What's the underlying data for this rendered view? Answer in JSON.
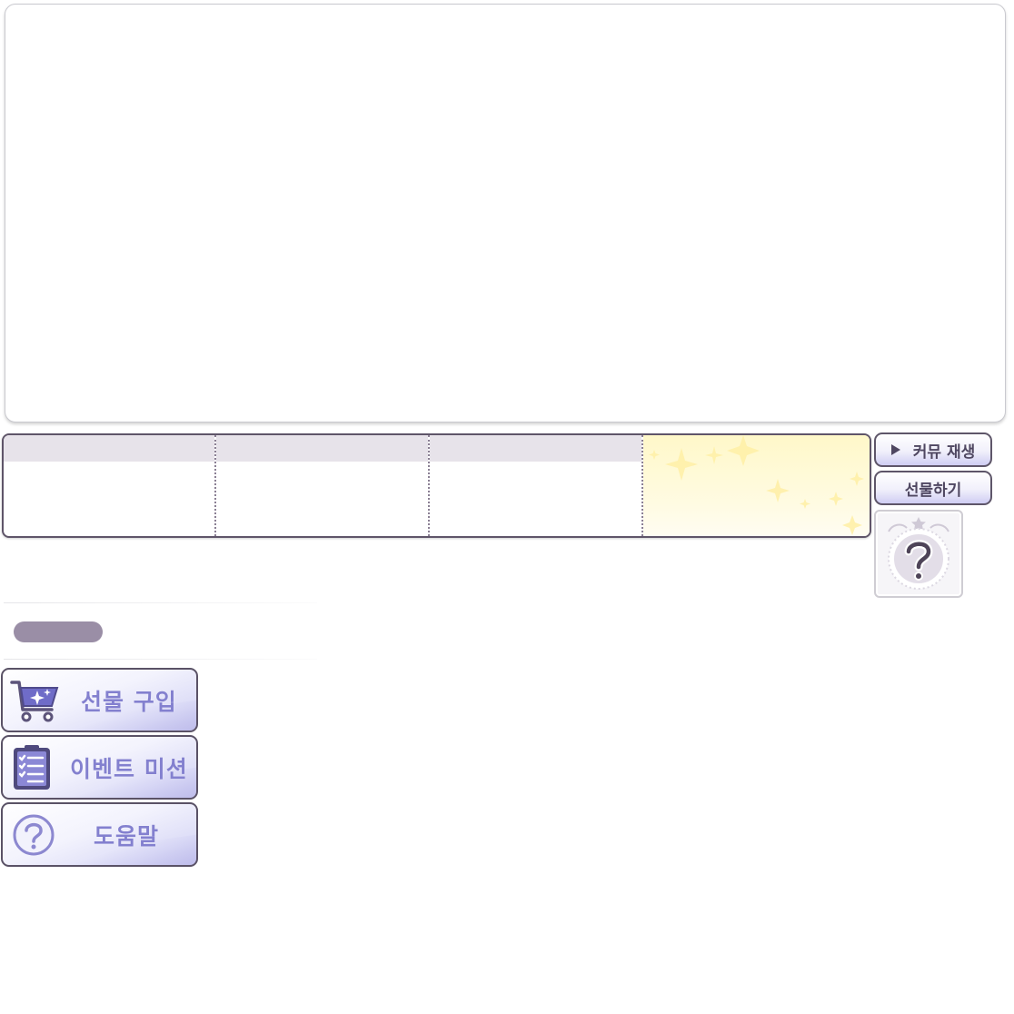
{
  "controls": {
    "replay_label": "커뮤 재생",
    "gift_label": "선물하기"
  },
  "menu": {
    "buy_gift_label": "선물 구입",
    "event_mission_label": "이벤트 미션",
    "help_label": "도움말"
  },
  "icons": {
    "play": "play-icon",
    "unknown": "question-mark-icon",
    "shop": "shopping-cart-icon",
    "mission": "checklist-icon",
    "help": "help-circle-icon"
  },
  "colors": {
    "accent_text": "#8380cf",
    "border": "#5a5266",
    "highlight_slot": "#fff8c9",
    "pill": "#9a8ea6"
  }
}
